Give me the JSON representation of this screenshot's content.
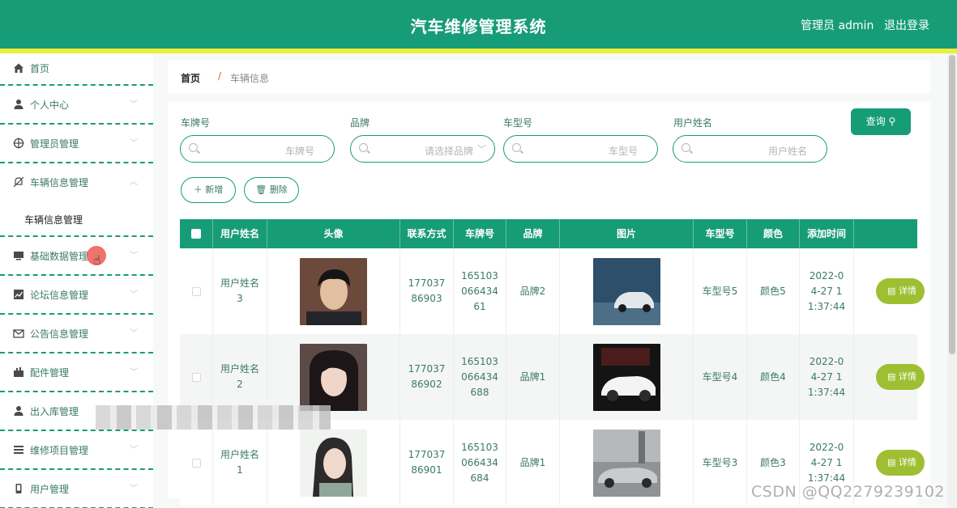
{
  "header": {
    "title": "汽车维修管理系统",
    "user": "管理员 admin",
    "logout": "退出登录"
  },
  "sidebar": {
    "items": [
      {
        "label": "首页",
        "icon": "home-icon"
      },
      {
        "label": "个人中心",
        "icon": "user-icon"
      },
      {
        "label": "管理员管理",
        "icon": "target-icon"
      },
      {
        "label": "车辆信息管理",
        "icon": "bell-off-icon"
      },
      {
        "label": "基础数据管理",
        "icon": "monitor-icon"
      },
      {
        "label": "论坛信息管理",
        "icon": "chart-icon"
      },
      {
        "label": "公告信息管理",
        "icon": "mail-icon"
      },
      {
        "label": "配件管理",
        "icon": "toolbox-icon"
      },
      {
        "label": "出入库管理",
        "icon": "user-icon"
      },
      {
        "label": "维修项目管理",
        "icon": "list-icon"
      },
      {
        "label": "用户管理",
        "icon": "phone-icon"
      }
    ],
    "submenu": "车辆信息管理"
  },
  "breadcrumb": {
    "home": "首页",
    "sep": "/",
    "current": "车辆信息"
  },
  "search": {
    "plate_label": "车牌号",
    "plate_placeholder": "车牌号",
    "brand_label": "品牌",
    "brand_placeholder": "请选择品牌",
    "model_label": "车型号",
    "model_placeholder": "车型号",
    "user_label": "用户姓名",
    "user_placeholder": "用户姓名",
    "search_button": "查询"
  },
  "actions": {
    "add": "新增",
    "delete": "删除"
  },
  "table": {
    "headers": [
      "用户姓名",
      "头像",
      "联系方式",
      "车牌号",
      "品牌",
      "图片",
      "车型号",
      "颜色",
      "添加时间"
    ],
    "rows": [
      {
        "user": "用户姓名3",
        "phone": "17703786903",
        "plate": "16510306643461",
        "brand": "品牌2",
        "model": "车型号5",
        "color": "颜色5",
        "time": "2022-04-27 11:37:44",
        "detail": "详情"
      },
      {
        "user": "用户姓名2",
        "phone": "17703786902",
        "plate": "165103066434688",
        "brand": "品牌1",
        "model": "车型号4",
        "color": "颜色4",
        "time": "2022-04-27 11:37:44",
        "detail": "详情"
      },
      {
        "user": "用户姓名1",
        "phone": "17703786901",
        "plate": "165103066434684",
        "brand": "品牌1",
        "model": "车型号3",
        "color": "颜色3",
        "time": "2022-04-27 11:37:44",
        "detail": "详情"
      }
    ]
  },
  "watermark": "CSDN @QQ2279239102",
  "colors": {
    "primary": "#179c78",
    "accent": "#e9ef3b",
    "detail": "#9fbf32"
  }
}
